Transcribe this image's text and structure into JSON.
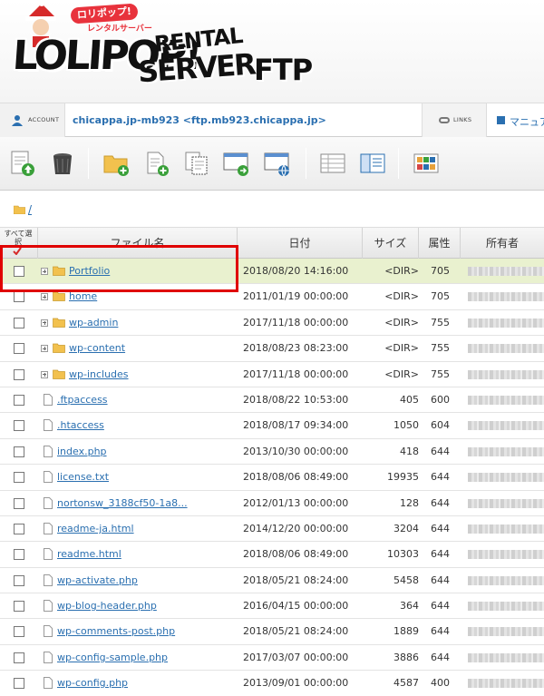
{
  "header": {
    "catch_line1": "ロリポップ!",
    "catch_line2": "レンタルサーバー",
    "logo_main": "LOLIPOP!",
    "logo_rental": "RENTAL",
    "logo_server": "SERVER",
    "logo_ftp": "FTP"
  },
  "account_bar": {
    "account_label": "ACCOUNT",
    "host": "chicappa.jp-mb923 <ftp.mb923.chicappa.jp>",
    "links_label": "LINKS",
    "manual_label": "マニュアル"
  },
  "toolbar": {
    "icons": [
      "upload-icon",
      "trash-icon",
      "new-folder-icon",
      "new-file-icon",
      "copy-icon",
      "move-icon",
      "web-open-icon",
      "list-view-icon",
      "split-view-icon",
      "thumbnail-view-icon"
    ]
  },
  "path": {
    "current": "/"
  },
  "table": {
    "select_all_label": "すべて選択",
    "columns": {
      "name": "ファイル名",
      "date": "日付",
      "size": "サイズ",
      "perm": "属性",
      "owner": "所有者"
    },
    "rows": [
      {
        "type": "dir",
        "name": "Portfolio",
        "date": "2018/08/20 14:16:00",
        "size": "<DIR>",
        "perm": "705",
        "selected": true
      },
      {
        "type": "dir",
        "name": "home",
        "date": "2011/01/19 00:00:00",
        "size": "<DIR>",
        "perm": "705"
      },
      {
        "type": "dir",
        "name": "wp-admin",
        "date": "2017/11/18 00:00:00",
        "size": "<DIR>",
        "perm": "755"
      },
      {
        "type": "dir",
        "name": "wp-content",
        "date": "2018/08/23 08:23:00",
        "size": "<DIR>",
        "perm": "755"
      },
      {
        "type": "dir",
        "name": "wp-includes",
        "date": "2017/11/18 00:00:00",
        "size": "<DIR>",
        "perm": "755"
      },
      {
        "type": "file",
        "name": ".ftpaccess",
        "date": "2018/08/22 10:53:00",
        "size": "405",
        "perm": "600"
      },
      {
        "type": "file",
        "name": ".htaccess",
        "date": "2018/08/17 09:34:00",
        "size": "1050",
        "perm": "604"
      },
      {
        "type": "file",
        "name": "index.php",
        "date": "2013/10/30 00:00:00",
        "size": "418",
        "perm": "644"
      },
      {
        "type": "file",
        "name": "license.txt",
        "date": "2018/08/06 08:49:00",
        "size": "19935",
        "perm": "644"
      },
      {
        "type": "file",
        "name": "nortonsw_3188cf50-1a8...",
        "date": "2012/01/13 00:00:00",
        "size": "128",
        "perm": "644"
      },
      {
        "type": "file",
        "name": "readme-ja.html",
        "date": "2014/12/20 00:00:00",
        "size": "3204",
        "perm": "644"
      },
      {
        "type": "file",
        "name": "readme.html",
        "date": "2018/08/06 08:49:00",
        "size": "10303",
        "perm": "644"
      },
      {
        "type": "file",
        "name": "wp-activate.php",
        "date": "2018/05/21 08:24:00",
        "size": "5458",
        "perm": "644"
      },
      {
        "type": "file",
        "name": "wp-blog-header.php",
        "date": "2016/04/15 00:00:00",
        "size": "364",
        "perm": "644"
      },
      {
        "type": "file",
        "name": "wp-comments-post.php",
        "date": "2018/05/21 08:24:00",
        "size": "1889",
        "perm": "644"
      },
      {
        "type": "file",
        "name": "wp-config-sample.php",
        "date": "2017/03/07 00:00:00",
        "size": "3886",
        "perm": "644"
      },
      {
        "type": "file",
        "name": "wp-config.php",
        "date": "2013/09/01 00:00:00",
        "size": "4587",
        "perm": "400"
      }
    ]
  },
  "colors": {
    "link": "#2a6fb0",
    "selected_row": "#e9f1cf",
    "highlight_box": "#e00000",
    "folder": "#f2c14e"
  }
}
